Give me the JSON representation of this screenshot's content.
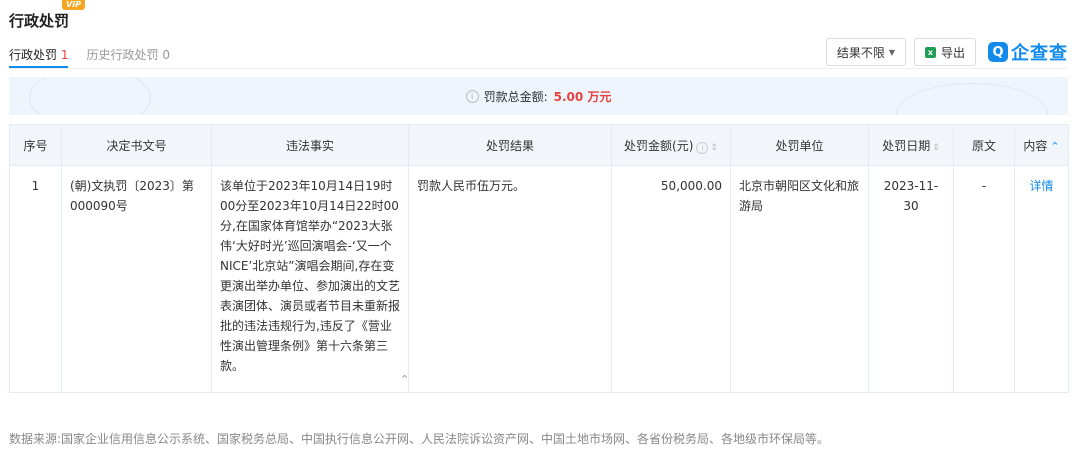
{
  "header": {
    "vip_badge": "VIP",
    "title": "行政处罚"
  },
  "tabs": [
    {
      "label": "行政处罚",
      "count": "1"
    },
    {
      "label": "历史行政处罚",
      "count": "0"
    }
  ],
  "toolbar": {
    "filter_label": "结果不限",
    "export_label": "导出",
    "brand": "企查查"
  },
  "summary": {
    "label": "罚款总金额:",
    "amount": "5.00 万元"
  },
  "table": {
    "headers": [
      "序号",
      "决定书文号",
      "违法事实",
      "处罚结果",
      "处罚金额(元)",
      "处罚单位",
      "处罚日期",
      "原文",
      "内容"
    ],
    "rows": [
      {
        "index": "1",
        "doc_no": "(朝)文执罚〔2023〕第000090号",
        "facts": "该单位于2023年10月14日19时00分至2023年10月14日22时00分,在国家体育馆举办“2023大张伟‘大好时光’巡回演唱会-‘又一个NICE’北京站”演唱会期间,存在变更演出举办单位、参加演出的文艺表演团体、演员或者节目未重新报批的违法违规行为,违反了《营业性演出管理条例》第十六条第三款。",
        "result": "罚款人民币伍万元。",
        "amount": "50,000.00",
        "authority": "北京市朝阳区文化和旅游局",
        "date": "2023-11-30",
        "original": "-",
        "detail": "详情"
      }
    ]
  },
  "footer": {
    "source": "数据来源:国家企业信用信息公示系统、国家税务总局、中国执行信息公开网、人民法院诉讼资产网、中国土地市场网、各省份税务局、各地级市环保局等。"
  }
}
